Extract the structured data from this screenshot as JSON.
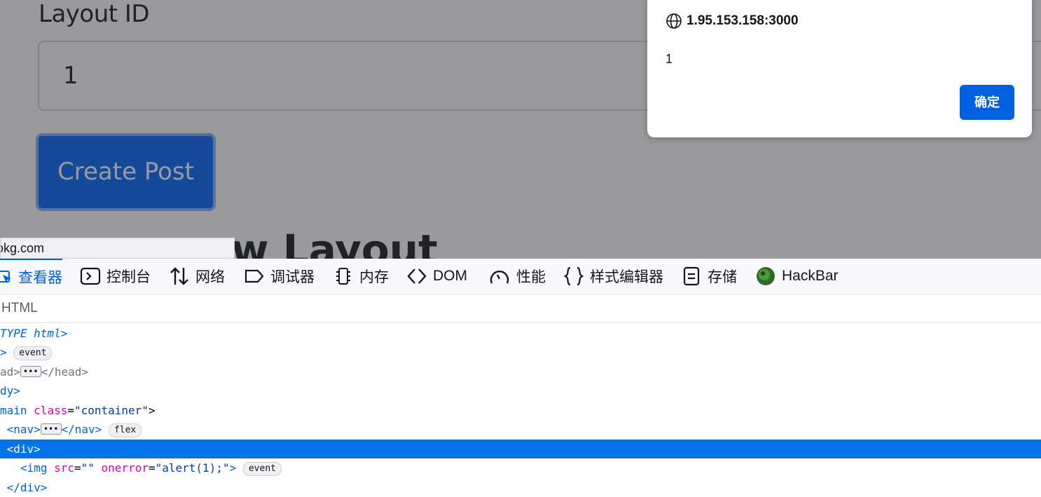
{
  "page": {
    "layout_label": "Layout ID",
    "layout_value": "1",
    "create_button": "Create Post",
    "partial_heading": "w Layout",
    "status_url": "okg.com"
  },
  "dialog": {
    "origin": "1.95.153.158:3000",
    "message": "1",
    "ok_label": "确定"
  },
  "devtools": {
    "tabs": [
      {
        "label": "查看器",
        "icon": "inspector-icon"
      },
      {
        "label": "控制台",
        "icon": "console-icon"
      },
      {
        "label": "网络",
        "icon": "network-icon"
      },
      {
        "label": "调试器",
        "icon": "debugger-icon"
      },
      {
        "label": "内存",
        "icon": "memory-icon"
      },
      {
        "label": "DOM",
        "icon": "dom-icon"
      },
      {
        "label": "性能",
        "icon": "performance-icon"
      },
      {
        "label": "样式编辑器",
        "icon": "style-editor-icon"
      },
      {
        "label": "存储",
        "icon": "storage-icon"
      },
      {
        "label": "HackBar",
        "icon": "hackbar-icon"
      }
    ],
    "breadcrumb": "HTML",
    "tree": {
      "doctype": "TYPE html>",
      "html_open": ">",
      "event_badge": "event",
      "head_open": "ad>",
      "head_close": "</head>",
      "body_open": "dy>",
      "main_tag": "main",
      "main_attr": "class",
      "main_val": "\"container\"",
      "nav_open": "<nav>",
      "nav_close": "</nav>",
      "flex_badge": "flex",
      "div_open": "<div>",
      "img_tag": "<img",
      "img_src_attr": "src",
      "img_src_val": "\"\"",
      "img_onerror_attr": "onerror",
      "img_onerror_val": "\"alert(1);\"",
      "div_close": "</div>",
      "ellipsis": "•••"
    }
  },
  "colors": {
    "accent": "#0061e0",
    "selection": "#0074e8",
    "primary_button": "#0d6efd"
  }
}
